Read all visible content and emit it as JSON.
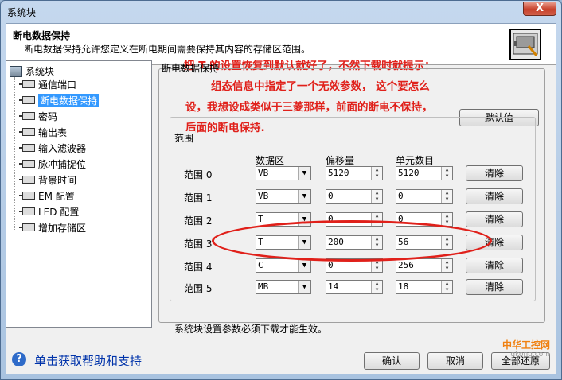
{
  "window": {
    "title": "系统块",
    "close_label": "X"
  },
  "header": {
    "title": "断电数据保持",
    "description": "断电数据保持允许您定义在断电期间需要保持其内容的存储区范围。"
  },
  "annotation": {
    "line1": "把 T 的设置恢复到默认就好了，不然下载时就提示：",
    "line2": "组态信息中指定了一个无效参数， 这个要怎么",
    "line3": "设，我想设成类似于三菱那样，前面的断电不保持，",
    "line4": "后面的断电保持."
  },
  "tree": {
    "root": "系统块",
    "items": [
      {
        "label": "通信端口"
      },
      {
        "label": "断电数据保持",
        "selected": true
      },
      {
        "label": "密码"
      },
      {
        "label": "输出表"
      },
      {
        "label": "输入滤波器"
      },
      {
        "label": "脉冲捕捉位"
      },
      {
        "label": "背景时间"
      },
      {
        "label": "EM 配置"
      },
      {
        "label": "LED 配置"
      },
      {
        "label": "增加存储区"
      }
    ]
  },
  "panel": {
    "title": "断电数据保持",
    "default_button": "默认值",
    "group_label": "范围",
    "columns": {
      "area": "数据区",
      "offset": "偏移量",
      "count": "单元数目"
    },
    "clear_label": "清除",
    "rows": [
      {
        "label": "范围 0",
        "area": "VB",
        "offset": "5120",
        "count": "5120"
      },
      {
        "label": "范围 1",
        "area": "VB",
        "offset": "0",
        "count": "0"
      },
      {
        "label": "范围 2",
        "area": "T",
        "offset": "0",
        "count": "0"
      },
      {
        "label": "范围 3",
        "area": "T",
        "offset": "200",
        "count": "56"
      },
      {
        "label": "范围 4",
        "area": "C",
        "offset": "0",
        "count": "256"
      },
      {
        "label": "范围 5",
        "area": "MB",
        "offset": "14",
        "count": "18"
      }
    ],
    "note": "系统块设置参数必须下载才能生效。"
  },
  "footer": {
    "help": "单击获取帮助和支持",
    "ok": "确认",
    "cancel": "取消",
    "restore_all": "全部还原"
  },
  "watermark": {
    "text": "中华工控网",
    "url": "gkong.com"
  }
}
